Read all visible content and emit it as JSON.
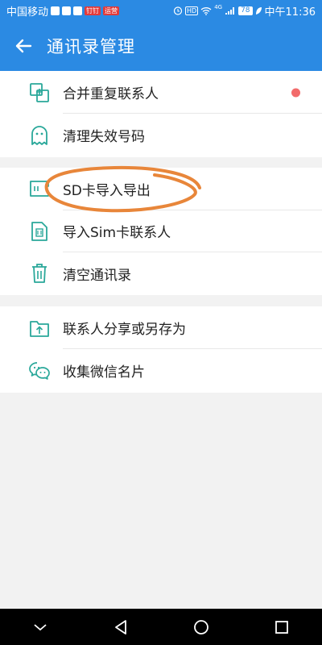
{
  "status_bar": {
    "carrier": "中国移动",
    "badge": "钉钉",
    "badge2": "运营",
    "hd": "HD",
    "network": "4G",
    "battery": "78",
    "time": "中午11:36"
  },
  "header": {
    "title": "通讯录管理",
    "back_icon": "arrow-left-icon"
  },
  "groups": [
    {
      "items": [
        {
          "label": "合并重复联系人",
          "icon": "merge-icon",
          "has_dot": true
        },
        {
          "label": "清理失效号码",
          "icon": "ghost-icon"
        }
      ]
    },
    {
      "items": [
        {
          "label": "SD卡导入导出",
          "icon": "sd-card-icon"
        },
        {
          "label": "导入Sim卡联系人",
          "icon": "sim-card-icon"
        },
        {
          "label": "清空通讯录",
          "icon": "trash-icon"
        }
      ]
    },
    {
      "items": [
        {
          "label": "联系人分享或另存为",
          "icon": "folder-upload-icon"
        },
        {
          "label": "收集微信名片",
          "icon": "wechat-icon"
        }
      ]
    }
  ],
  "colors": {
    "primary": "#2b8ae3",
    "icon": "#2aa89a",
    "dot": "#f26b6b",
    "annotation": "#e8863a"
  }
}
